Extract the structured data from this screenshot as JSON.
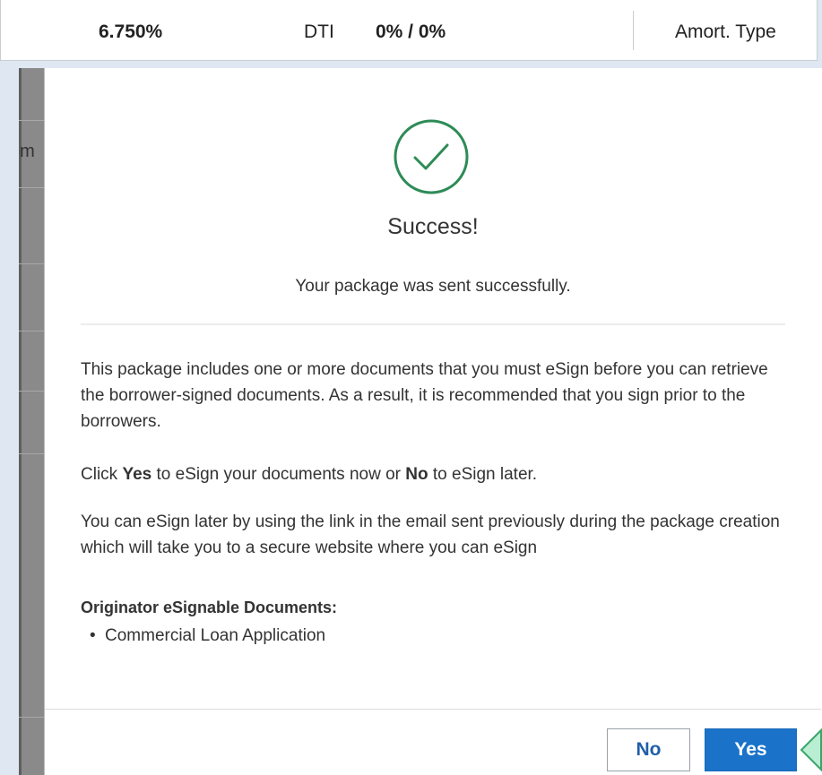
{
  "topbar": {
    "rate": "6.750%",
    "dti_label": "DTI",
    "dti_value": "0% / 0%",
    "amort_label": "Amort. Type"
  },
  "background": {
    "partial_label": "om"
  },
  "modal": {
    "title": "Success!",
    "subtitle": "Your package was sent successfully.",
    "paragraph1": "This package includes one or more documents that you must eSign before you can retrieve the borrower-signed documents. As a result, it is recommended that you sign prior to the borrowers.",
    "paragraph2_prefix": "Click ",
    "paragraph2_yes": "Yes",
    "paragraph2_middle": " to eSign your documents now or ",
    "paragraph2_no": "No",
    "paragraph2_suffix": " to eSign later.",
    "paragraph3": "You can eSign later by using the link in the email sent previously during the package creation which will take you to a secure website where you can eSign",
    "docs_heading": "Originator eSignable Documents:",
    "docs": [
      "Commercial Loan Application"
    ],
    "buttons": {
      "no_label": "No",
      "yes_label": "Yes"
    }
  },
  "colors": {
    "success_green": "#2e8b57",
    "primary_blue": "#1a73c9"
  }
}
